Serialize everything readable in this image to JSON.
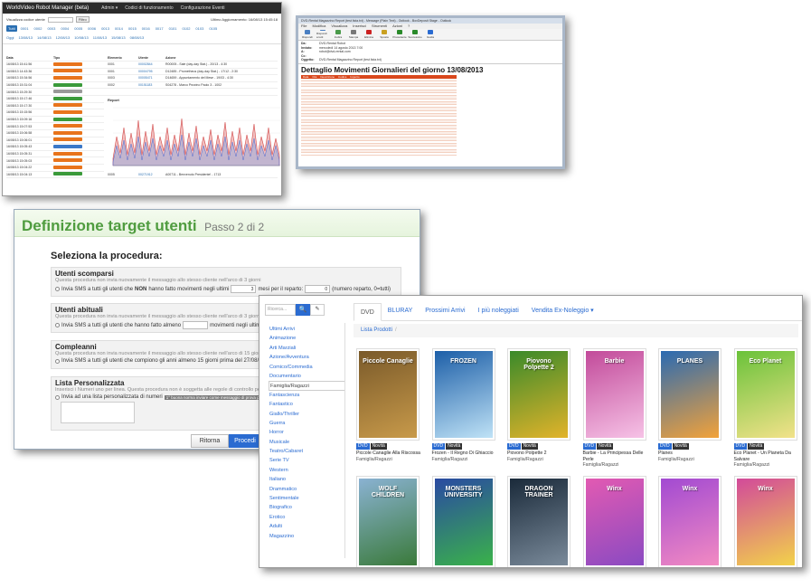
{
  "win1": {
    "brand": "WorldVideo Robot Manager (beta)",
    "nav": [
      "Admin ▾",
      "Codici di funzionamento",
      "Configurazione Eventi"
    ],
    "filter_label": "Visualizza codice utente",
    "filter_button": "Filtro",
    "last_update": "Ultimo Aggiornamento: 16/08/13 15:45:18",
    "pills": [
      "Tutti",
      "0001",
      "0002",
      "0003",
      "0004",
      "0005",
      "0006",
      "0013",
      "0014",
      "0015",
      "0016",
      "0017",
      "0101",
      "0102",
      "0103",
      "0105"
    ],
    "dates": [
      "Oggi",
      "13/08/13",
      "14/08/13",
      "12/08/13",
      "10/08/13",
      "11/08/13",
      "15/08/13",
      "08/08/13"
    ],
    "cols": [
      "Data",
      "Tipo",
      "Elemento",
      "Utente",
      "Azione"
    ],
    "rows": [
      {
        "d": "16/08/13 15:41:56",
        "t": "orange",
        "e": "0001",
        "u": "00002844",
        "a": "R00005 - Sale (day-day Stat.) - 20/13 - 4:30"
      },
      {
        "d": "16/08/13 14:43:36",
        "t": "orange",
        "e": "0001",
        "u": "00004795",
        "a": "D12485 - Prometheus (day-day Stat.) - 17/12 - 2:30"
      },
      {
        "d": "16/08/13 15:34:56",
        "t": "orange",
        "e": "0003",
        "u": "00005471",
        "a": "D14659 - Appuntamento del Mese - 19/03 - 4:30"
      },
      {
        "d": "16/08/13 15:31:04",
        "t": "green",
        "e": "0002",
        "u": "00151183",
        "a": "S04278 - Marco Pezzino Paolo 3 - 1002"
      },
      {
        "d": "16/08/13 15:29:30",
        "t": "gray",
        "e": "",
        "u": "",
        "a": ""
      },
      {
        "d": "16/08/13 15:17:46",
        "t": "green",
        "e": "",
        "u": "",
        "a": ""
      },
      {
        "d": "16/08/13 15:17:30",
        "t": "orange",
        "e": "",
        "u": "",
        "a": ""
      },
      {
        "d": "16/08/13 15:15:56",
        "t": "orange",
        "e": "",
        "u": "",
        "a": ""
      },
      {
        "d": "16/08/13 15:09:16",
        "t": "green",
        "e": "",
        "u": "",
        "a": ""
      },
      {
        "d": "16/08/13 15:07:53",
        "t": "orange",
        "e": "",
        "u": "",
        "a": ""
      },
      {
        "d": "16/08/13 15:06:58",
        "t": "orange",
        "e": "",
        "u": "",
        "a": ""
      },
      {
        "d": "16/08/13 15:06:01",
        "t": "orange",
        "e": "",
        "u": "",
        "a": ""
      },
      {
        "d": "16/08/13 15:05:43",
        "t": "blue",
        "e": "",
        "u": "",
        "a": ""
      },
      {
        "d": "16/08/13 15:05:31",
        "t": "orange",
        "e": "",
        "u": "",
        "a": ""
      },
      {
        "d": "16/08/13 15:05:03",
        "t": "orange",
        "e": "",
        "u": "",
        "a": ""
      },
      {
        "d": "16/08/13 15:04:22",
        "t": "orange",
        "e": "0006",
        "u": "00058058",
        "a": "A00336 - Hotel Transylvania - 17/13 - 2:30"
      },
      {
        "d": "16/08/13 15:04:13",
        "t": "green",
        "e": "0005",
        "u": "00271912",
        "a": "A00711 - Benvenuto Presidente! - 1713"
      }
    ],
    "chart_title": "Report"
  },
  "win2": {
    "title": "DVD-Rental Magazzino Report (test lista.txt) - Message (Plain Text) - Outlook - BoxDeposit Stage - Outlook",
    "menu": [
      "File",
      "Modifica",
      "Visualizza",
      "Inserisci",
      "Strumenti",
      "Azioni",
      "?"
    ],
    "tools": [
      {
        "l": "Rispondi",
        "c": "#4a7fc2"
      },
      {
        "l": "Rispondi a tutti",
        "c": "#4a7fc2"
      },
      {
        "l": "Inoltra",
        "c": "#4a9a4a"
      },
      {
        "l": "Stampa",
        "c": "#777"
      },
      {
        "l": "Elimina",
        "c": "#c22"
      },
      {
        "l": "Sposta",
        "c": "#c9a020"
      },
      {
        "l": "Precedente",
        "c": "#2a8a2a"
      },
      {
        "l": "Successivo",
        "c": "#2a8a2a"
      },
      {
        "l": "Guida",
        "c": "#2a6bd1"
      }
    ],
    "hdr": [
      {
        "k": "Da:",
        "v": "DVD-Rental Robot"
      },
      {
        "k": "Inviato:",
        "v": "mercoledì 14 agosto 2013 7:00"
      },
      {
        "k": "A:",
        "v": "robot@dvd-rental.com"
      },
      {
        "k": "Cc:",
        "v": ""
      },
      {
        "k": "Oggetto:",
        "v": "DVD-Rental Magazzino Report (test lista.txt)"
      }
    ],
    "doc_title": "Dettaglio Movimenti Giornalieri del giorno 13/08/2013",
    "table_cols": [
      "Data",
      "Ora",
      "Descrizione",
      "Codice",
      "Importo"
    ]
  },
  "win3": {
    "title": "Definizione target utenti",
    "step": "Passo 2 di 2",
    "select_title": "Seleziona la procedura:",
    "s1": {
      "title": "Utenti scomparsi",
      "desc": "Questa procedura non invia nuovamente il messaggio allo stesso cliente nell'arco di 3 giorni",
      "pre": "Invia SMS a tutti gli utenti che ",
      "bold": "NON",
      "mid": " hanno fatto movimenti negli ultimi",
      "v1": "3",
      "mid2": "mesi per il reparto:",
      "v2": "0",
      "post": "(numero reparto, 0=tutti)"
    },
    "s2": {
      "title": "Utenti abituali",
      "desc": "Questa procedura non invia nuovamente il messaggio allo stesso cliente nell'arco di 3 giorni",
      "pre": "Invia SMS a tutti gli utenti che hanno fatto almeno",
      "v1": "",
      "post": "movimenti negli ultimi"
    },
    "s3": {
      "title": "Compleanni",
      "desc": "Questa procedura non invia nuovamente il messaggio allo stesso cliente nell'arco di 15 giorni",
      "line": "Invia SMS a tutti gli utenti che compiono gli anni almeno 15 giorni prima del 27/08/2013 incluso"
    },
    "s4": {
      "title": "Lista Personalizzata",
      "desc": "Inserisci i Numeri uno per linea. Questa procedura non è soggetta alle regole di controllo per clienti",
      "line": "Invia ad una lista personalizzata di numeri",
      "opt": "1° buona norma inviare come messaggio di prova prima"
    },
    "btn_back": "Ritorna",
    "btn_next": "Procedi"
  },
  "win4": {
    "search_placeholder": "Ricerca...",
    "search_icon_glyph": "🔍",
    "edit_icon_glyph": "✎",
    "tabs": [
      "DVD",
      "BLURAY",
      "Prossimi Arrivi",
      "I più noleggiati",
      "Vendita Ex-Noleggio ▾"
    ],
    "breadcrumb": "Lista Prodotti",
    "categories": [
      "Ultimi Arrivi",
      "Animazione",
      "Arti Marziali",
      "Azione/Avventura",
      "Comico/Commedia",
      "Documentario",
      "Famiglia/Ragazzi",
      "Fantascienza",
      "Fantastico",
      "Giallo/Thriller",
      "Guerra",
      "Horror",
      "Musicale",
      "Teatro/Cabaret",
      "Serie TV",
      "Western",
      "Italiano",
      "Drammatico",
      "Sentimentale",
      "Biografico",
      "Erotico",
      "Adulti",
      "Magazzino"
    ],
    "selected_category": "Famiglia/Ragazzi",
    "tag_dvd": "DVD",
    "tag_new": "Novità",
    "products": [
      {
        "title": "Piccole Canaglie Alla Riscossa",
        "genre": "Famiglia/Ragazzi",
        "logo": "Piccole Canaglie",
        "c1": "#7a5a2a",
        "c2": "#c89a4a"
      },
      {
        "title": "Frozen - Il Regno Di Ghiaccio",
        "genre": "Famiglia/Ragazzi",
        "logo": "FROZEN",
        "c1": "#1d5fa8",
        "c2": "#bfe2f6"
      },
      {
        "title": "Piovono Polpette 2",
        "genre": "Famiglia/Ragazzi",
        "logo": "Piovono Polpette 2",
        "c1": "#3a8a2a",
        "c2": "#e2b32a"
      },
      {
        "title": "Barbie - La Principessa Delle Perle",
        "genre": "Famiglia/Ragazzi",
        "logo": "Barbie",
        "c1": "#c24a9a",
        "c2": "#f6c2e6"
      },
      {
        "title": "Planes",
        "genre": "Famiglia/Ragazzi",
        "logo": "PLANES",
        "c1": "#2a6ab2",
        "c2": "#f2a23a"
      },
      {
        "title": "Eco Planet - Un Pianeta Da Salvare",
        "genre": "Famiglia/Ragazzi",
        "logo": "Eco Planet",
        "c1": "#6ac23a",
        "c2": "#f2e28a"
      },
      {
        "title": "",
        "genre": "",
        "logo": "WOLF CHILDREN",
        "c1": "#8ab2d2",
        "c2": "#3a7a3a"
      },
      {
        "title": "",
        "genre": "",
        "logo": "MONSTERS UNIVERSITY",
        "c1": "#2a4aa2",
        "c2": "#3ab24a"
      },
      {
        "title": "",
        "genre": "",
        "logo": "DRAGON TRAINER",
        "c1": "#1a2a3a",
        "c2": "#7a8a9a"
      },
      {
        "title": "",
        "genre": "",
        "logo": "Winx",
        "c1": "#e25ab2",
        "c2": "#8a4ac2"
      },
      {
        "title": "",
        "genre": "",
        "logo": "Winx",
        "c1": "#a24ad2",
        "c2": "#f28ac2"
      },
      {
        "title": "",
        "genre": "",
        "logo": "Winx",
        "c1": "#d24a9a",
        "c2": "#f2d24a"
      }
    ]
  }
}
